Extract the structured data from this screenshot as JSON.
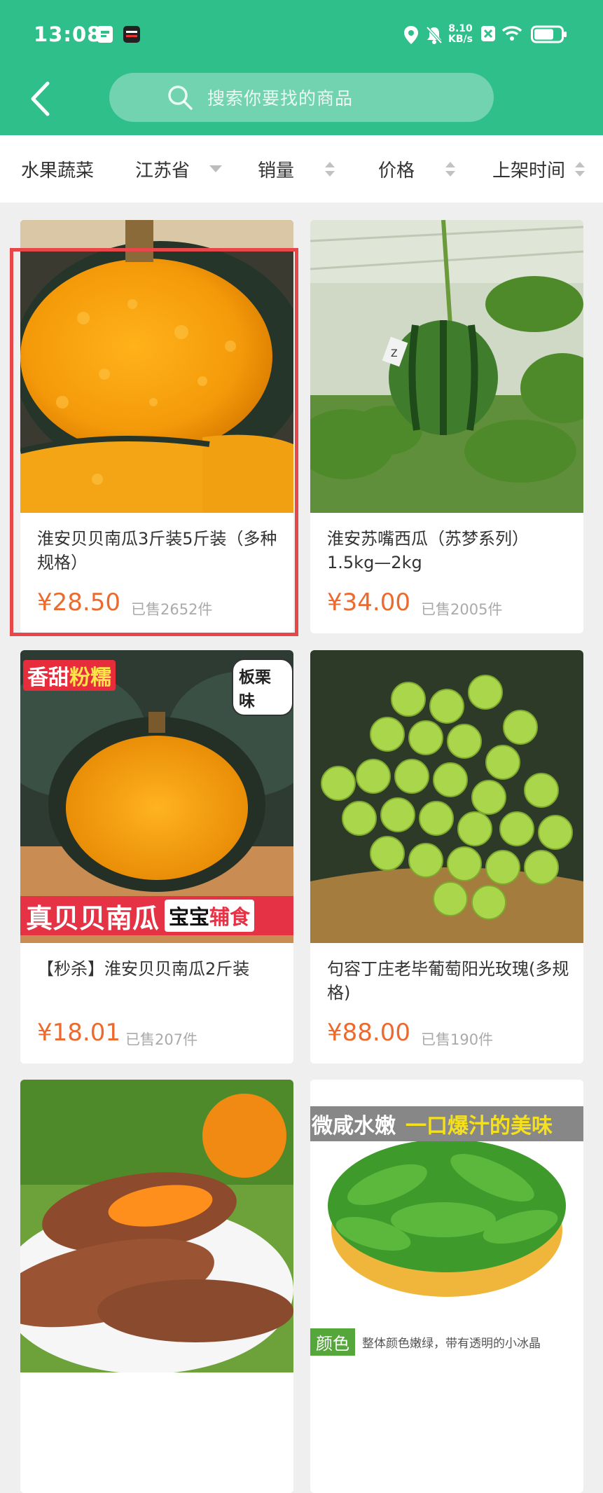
{
  "status_bar": {
    "time": "13:08",
    "net_speed_value": "8.10",
    "net_speed_unit": "KB/s",
    "icons": [
      "sim-card-icon",
      "app-badge-icon",
      "location-icon",
      "mute-bell-icon",
      "no-sim-icon",
      "wifi-icon",
      "battery-icon"
    ]
  },
  "header": {
    "back_icon": "chevron-left-icon",
    "search_placeholder": "搜索你要找的商品",
    "search_icon": "search-icon"
  },
  "filters": [
    {
      "label": "水果蔬菜",
      "indicator": "none"
    },
    {
      "label": "江苏省",
      "indicator": "dropdown"
    },
    {
      "label": "销量",
      "indicator": "sort"
    },
    {
      "label": "价格",
      "indicator": "sort"
    },
    {
      "label": "上架时间",
      "indicator": "sort"
    }
  ],
  "products": [
    {
      "title": "淮安贝贝南瓜3斤装5斤装（多种规格）",
      "price": "¥28.50",
      "sold": "已售2652件",
      "image": "pumpkin-cut-photo"
    },
    {
      "title": "淮安苏嘴西瓜（苏梦系列）1.5kg—2kg",
      "price": "¥34.00",
      "sold": "已售2005件",
      "image": "watermelon-vine-photo",
      "image_tag": "Z"
    },
    {
      "title": "【秒杀】淮安贝贝南瓜2斤装",
      "price": "¥18.01",
      "sold": "已售207件",
      "image": "pumpkin-promo-photo",
      "image_text": {
        "top_left_a": "香甜",
        "top_left_b": "粉糯",
        "top_right": "板栗味",
        "bottom_a": "真贝贝南瓜",
        "bottom_b": "宝宝",
        "bottom_c": "辅食"
      }
    },
    {
      "title": "句容丁庄老毕葡萄阳光玫瑰(多规格)",
      "price": "¥88.00",
      "sold": "已售190件",
      "image": "grapes-photo"
    },
    {
      "title": "",
      "price": "",
      "sold": "",
      "image": "sweet-potato-photo"
    },
    {
      "title": "",
      "price": "",
      "sold": "",
      "image": "vegetable-basket-photo",
      "image_text": {
        "banner_a": "微咸水嫩",
        "banner_b": "一口爆汁的美味",
        "bottom_a": "颜色",
        "bottom_b": "整体颜色嫩绿，带有透明的小冰晶"
      }
    }
  ],
  "colors": {
    "brand": "#2fbf8a",
    "price": "#ec6a2e",
    "highlight": "#e8474a"
  }
}
